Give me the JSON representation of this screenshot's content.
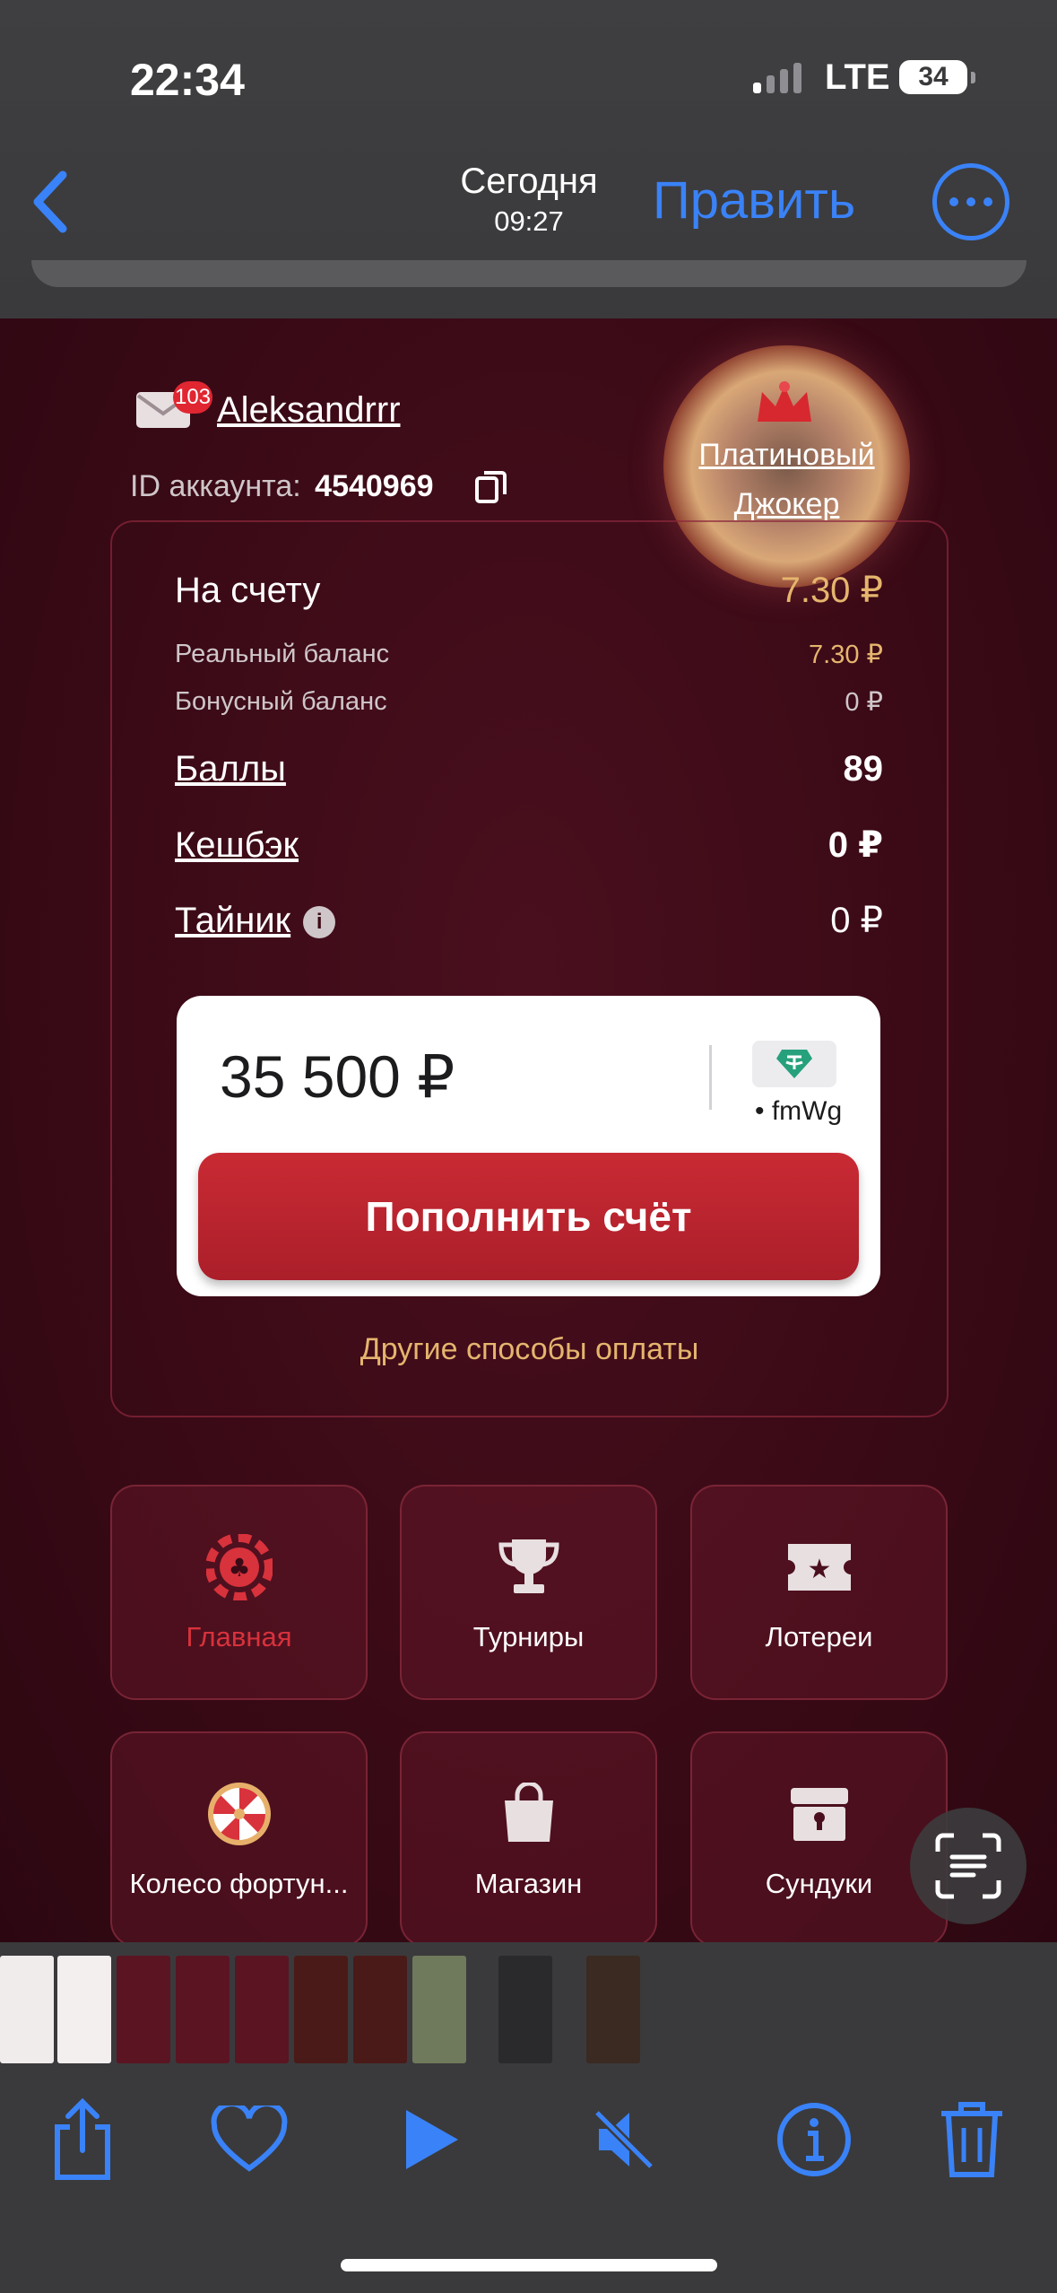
{
  "status_bar": {
    "time": "22:34",
    "network": "LTE",
    "battery": "34"
  },
  "nav": {
    "back_icon": "chevron-left-icon",
    "date": "Сегодня",
    "time": "09:27",
    "edit_label": "Править",
    "more_icon": "ellipsis-circle-icon"
  },
  "account": {
    "mail_badge": "103",
    "username": "Aleksandrrr",
    "id_label": "ID аккаунта:",
    "id_value": "4540969",
    "level_line1": "Платиновый",
    "level_line2": "Джокер"
  },
  "balance": {
    "on_account_label": "На счету",
    "on_account_value": "7.30 ₽",
    "real_label": "Реальный баланс",
    "real_value": "7.30 ₽",
    "bonus_label": "Бонусный баланс",
    "bonus_value": "0 ₽",
    "points_label": "Баллы",
    "points_value": "89",
    "cashback_label": "Кешбэк",
    "cashback_value": "0 ₽",
    "stash_label": "Тайник",
    "stash_value": "0 ₽"
  },
  "deposit": {
    "amount": "35 500 ₽",
    "wallet": "• fmWg",
    "button": "Пополнить счёт",
    "other_methods": "Другие способы оплаты"
  },
  "menu": [
    {
      "label": "Главная",
      "icon": "poker-chip-icon",
      "active": true
    },
    {
      "label": "Турниры",
      "icon": "trophy-icon"
    },
    {
      "label": "Лотереи",
      "icon": "ticket-icon"
    },
    {
      "label": "Колесо фортун...",
      "icon": "fortune-wheel-icon"
    },
    {
      "label": "Магазин",
      "icon": "shopping-bag-icon"
    },
    {
      "label": "Сундуки",
      "icon": "chest-icon"
    }
  ],
  "toolbar": {
    "share_icon": "share-icon",
    "like_icon": "heart-icon",
    "play_icon": "play-icon",
    "mute_icon": "speaker-muted-icon",
    "info_icon": "info-icon",
    "delete_icon": "trash-icon"
  },
  "colors": {
    "accent": "#3a82f7",
    "gold": "#e5b56e",
    "primary_button": "#c92a33",
    "background": "#3a0a16"
  }
}
